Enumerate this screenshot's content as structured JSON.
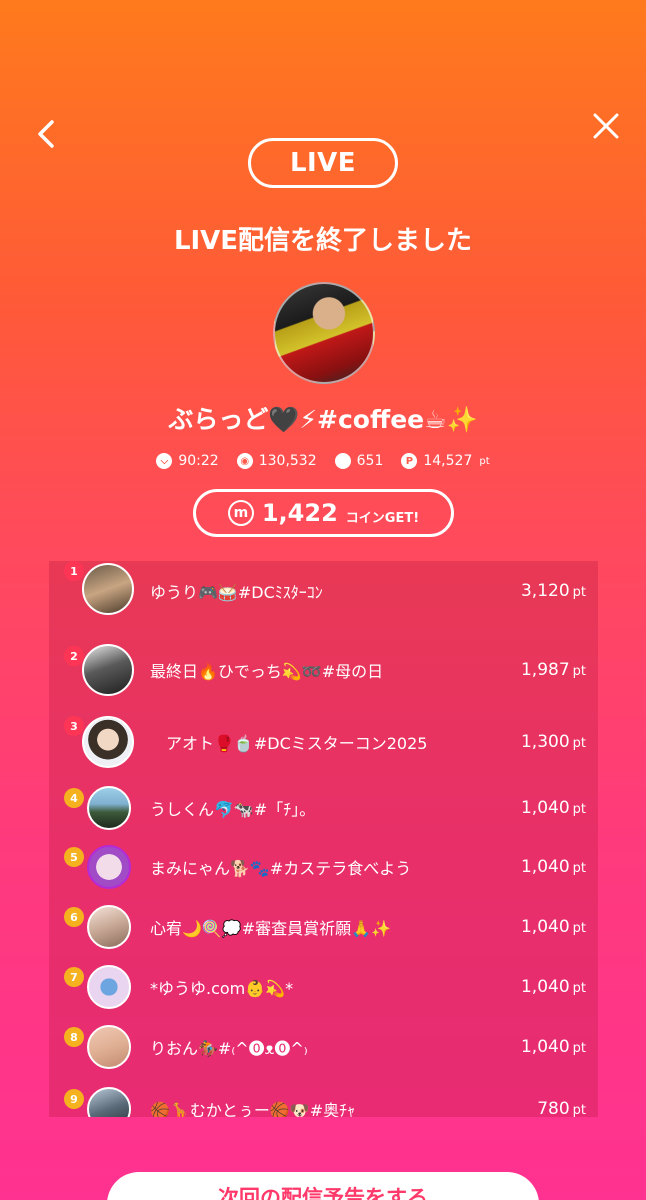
{
  "header": {
    "live_label": "LIVE",
    "title": "LIVE配信を終了しました"
  },
  "host": {
    "name": "ぶらっど🖤⚡#coffee☕✨"
  },
  "stats": {
    "duration": "90:22",
    "views": "130,532",
    "comments": "651",
    "points": "14,527",
    "points_unit": "pt"
  },
  "coin": {
    "amount": "1,422",
    "label": "コインGET!"
  },
  "ranking": [
    {
      "rank": "1",
      "name": "ゆうり🎮🥁#DCﾐｽﾀｰｺﾝ",
      "points": "3,120",
      "unit": "pt"
    },
    {
      "rank": "2",
      "name": "最終日🔥ひでっち💫➿#母の日",
      "points": "1,987",
      "unit": "pt"
    },
    {
      "rank": "3",
      "name": "　アオト🥊🍵#DCミスターコン2025",
      "points": "1,300",
      "unit": "pt"
    },
    {
      "rank": "4",
      "name": "うしくん🐬🐄#「ﾁ」。",
      "points": "1,040",
      "unit": "pt"
    },
    {
      "rank": "5",
      "name": "まみにゃん🐕🐾#カステラ食べよう",
      "points": "1,040",
      "unit": "pt"
    },
    {
      "rank": "6",
      "name": "心宥🌙🍭💭#審査員賞祈願🙏✨",
      "points": "1,040",
      "unit": "pt"
    },
    {
      "rank": "7",
      "name": "*ゆうゆ.com👶💫*",
      "points": "1,040",
      "unit": "pt"
    },
    {
      "rank": "8",
      "name": "りおん🏇#₍^⓿ᴥ⓿^₎",
      "points": "1,040",
      "unit": "pt"
    },
    {
      "rank": "9",
      "name": "🏀🦒むかとぅー🏀🐶#奥ﾁｬ",
      "points": "780",
      "unit": "pt"
    }
  ],
  "cta": {
    "label": "次回の配信予告をする"
  }
}
